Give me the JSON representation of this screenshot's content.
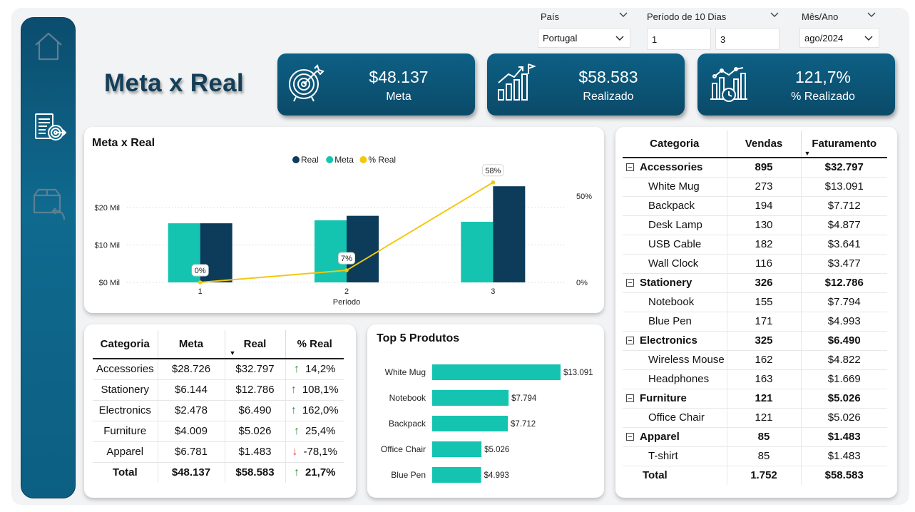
{
  "filters": {
    "pais": {
      "label": "País",
      "value": "Portugal"
    },
    "periodo": {
      "label": "Período de 10 Dias",
      "from": "1",
      "to": "3"
    },
    "mes_ano": {
      "label": "Mês/Ano",
      "value": "ago/2024"
    }
  },
  "title": "Meta x Real",
  "kpis": [
    {
      "value": "$48.137",
      "label": "Meta",
      "icon": "target-icon"
    },
    {
      "value": "$58.583",
      "label": "Realizado",
      "icon": "growth-chart-icon"
    },
    {
      "value": "121,7%",
      "label": "% Realizado",
      "icon": "analytics-clock-icon"
    }
  ],
  "sidebar": {
    "items": [
      {
        "icon": "home-icon"
      },
      {
        "icon": "report-target-icon"
      },
      {
        "icon": "box-return-icon"
      }
    ]
  },
  "chart_data": [
    {
      "type": "bar",
      "title": "Meta x Real",
      "xlabel": "Período",
      "categories": [
        "1",
        "2",
        "3"
      ],
      "series": [
        {
          "name": "Real",
          "values": [
            15.8,
            17.8,
            25.7
          ],
          "color": "#0d3b5a"
        },
        {
          "name": "Meta",
          "values": [
            15.8,
            16.6,
            16.2
          ],
          "color": "#14c4b0"
        },
        {
          "name": "% Real",
          "values": [
            0,
            7,
            58
          ],
          "color": "#f2c80f",
          "type": "line",
          "axis": "right",
          "labels": [
            "0%",
            "7%",
            "58%"
          ]
        }
      ],
      "y_ticks": [
        "$0 Mil",
        "$10 Mil",
        "$20 Mil"
      ],
      "y_tick_values": [
        0,
        10,
        20
      ],
      "ylim": [
        0,
        26.5
      ],
      "y2_ticks": [
        "0%",
        "50%"
      ],
      "y2_tick_values": [
        0,
        50
      ],
      "y2lim": [
        0,
        57.5
      ],
      "legend": "top-center",
      "grid": true
    },
    {
      "type": "bar",
      "orientation": "horizontal",
      "title": "Top 5 Produtos",
      "categories": [
        "White Mug",
        "Notebook",
        "Backpack",
        "Office Chair",
        "Blue Pen"
      ],
      "values": [
        13091,
        7794,
        7712,
        5026,
        4993
      ],
      "labels": [
        "$13.091",
        "$7.794",
        "$7.712",
        "$5.026",
        "$4.993"
      ],
      "color": "#14c4b0"
    }
  ],
  "meta_table": {
    "headers": [
      "Categoria",
      "Meta",
      "Real",
      "% Real"
    ],
    "rows": [
      {
        "cat": "Accessories",
        "meta": "$28.726",
        "real": "$32.797",
        "pct": "14,2%",
        "dir": "up"
      },
      {
        "cat": "Stationery",
        "meta": "$6.144",
        "real": "$12.786",
        "pct": "108,1%",
        "dir": "up"
      },
      {
        "cat": "Electronics",
        "meta": "$2.478",
        "real": "$6.490",
        "pct": "162,0%",
        "dir": "up"
      },
      {
        "cat": "Furniture",
        "meta": "$4.009",
        "real": "$5.026",
        "pct": "25,4%",
        "dir": "up"
      },
      {
        "cat": "Apparel",
        "meta": "$6.781",
        "real": "$1.483",
        "pct": "-78,1%",
        "dir": "down"
      }
    ],
    "total": {
      "cat": "Total",
      "meta": "$48.137",
      "real": "$58.583",
      "pct": "21,7%",
      "dir": "up"
    }
  },
  "matrix": {
    "headers": [
      "Categoria",
      "Vendas",
      "Faturamento"
    ],
    "groups": [
      {
        "name": "Accessories",
        "vendas": "895",
        "fat": "$32.797",
        "items": [
          {
            "name": "White Mug",
            "vendas": "273",
            "fat": "$13.091"
          },
          {
            "name": "Backpack",
            "vendas": "194",
            "fat": "$7.712"
          },
          {
            "name": "Desk Lamp",
            "vendas": "130",
            "fat": "$4.877"
          },
          {
            "name": "USB Cable",
            "vendas": "182",
            "fat": "$3.641"
          },
          {
            "name": "Wall Clock",
            "vendas": "116",
            "fat": "$3.477"
          }
        ]
      },
      {
        "name": "Stationery",
        "vendas": "326",
        "fat": "$12.786",
        "items": [
          {
            "name": "Notebook",
            "vendas": "155",
            "fat": "$7.794"
          },
          {
            "name": "Blue Pen",
            "vendas": "171",
            "fat": "$4.993"
          }
        ]
      },
      {
        "name": "Electronics",
        "vendas": "325",
        "fat": "$6.490",
        "items": [
          {
            "name": "Wireless Mouse",
            "vendas": "162",
            "fat": "$4.822"
          },
          {
            "name": "Headphones",
            "vendas": "163",
            "fat": "$1.669"
          }
        ]
      },
      {
        "name": "Furniture",
        "vendas": "121",
        "fat": "$5.026",
        "items": [
          {
            "name": "Office Chair",
            "vendas": "121",
            "fat": "$5.026"
          }
        ]
      },
      {
        "name": "Apparel",
        "vendas": "85",
        "fat": "$1.483",
        "items": [
          {
            "name": "T-shirt",
            "vendas": "85",
            "fat": "$1.483"
          }
        ]
      }
    ],
    "total": {
      "name": "Total",
      "vendas": "1.752",
      "fat": "$58.583"
    }
  }
}
